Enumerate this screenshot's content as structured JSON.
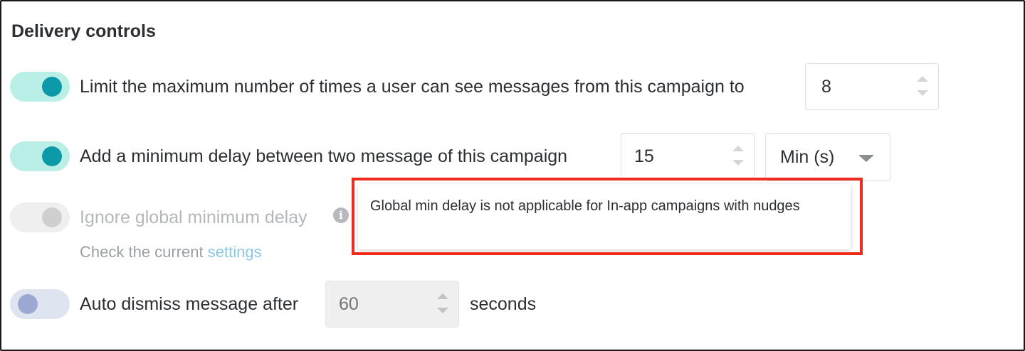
{
  "section": {
    "title": "Delivery controls"
  },
  "rows": {
    "max_views": {
      "label": "Limit the maximum number of times a user can see messages from this campaign to",
      "value": "8",
      "enabled": true
    },
    "min_delay": {
      "label": "Add a minimum delay between two message of this campaign",
      "value": "15",
      "unit": "Min (s)",
      "enabled": true
    },
    "ignore_global": {
      "label": "Ignore global minimum delay",
      "enabled": false,
      "disabled": true,
      "info_icon": "info-icon",
      "sub_prefix": "Check the current",
      "sub_link": "settings"
    },
    "auto_dismiss": {
      "label": "Auto dismiss message after",
      "placeholder": "60",
      "suffix": "seconds",
      "enabled": false
    }
  },
  "tooltip": {
    "text": "Global min delay is not applicable for In-app campaigns with nudges"
  },
  "colors": {
    "toggle_on_track": "#b9efe7",
    "toggle_on_knob": "#0d9aa8",
    "toggle_off_track": "#dfe4f1",
    "toggle_off_knob": "#9ba9d3",
    "link": "#8cc7e3",
    "highlight": "#ee2b1c"
  }
}
